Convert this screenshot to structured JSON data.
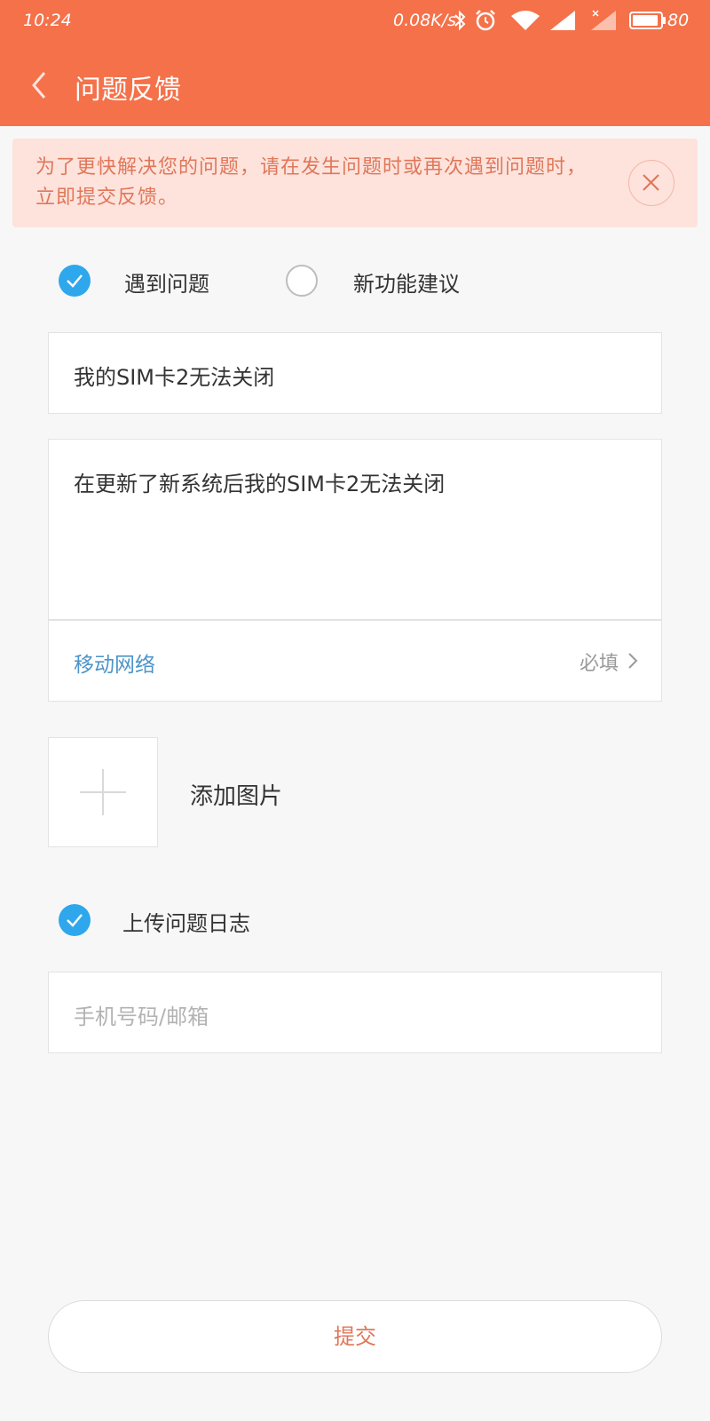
{
  "status_bar": {
    "time": "10:24",
    "network_speed": "0.08K/s",
    "battery": "80",
    "icons": [
      "bluetooth-icon",
      "alarm-icon",
      "wifi-icon",
      "signal-icon",
      "signal-no-sim-icon",
      "battery-icon"
    ]
  },
  "header": {
    "title": "问题反馈",
    "back_icon": "chevron-left-icon",
    "background_color": "#f4714a"
  },
  "notice": {
    "text": "为了更快解决您的问题，请在发生问题时或再次遇到问题时，立即提交反馈。",
    "close_icon": "close-icon"
  },
  "feedback_type": {
    "options": [
      {
        "label": "遇到问题",
        "selected": true
      },
      {
        "label": "新功能建议",
        "selected": false
      }
    ]
  },
  "form": {
    "title_value": "我的SIM卡2无法关闭",
    "description_value": "在更新了新系统后我的SIM卡2无法关闭",
    "category_label": "移动网络",
    "category_required": "必填",
    "add_image_label": "添加图片",
    "upload_log_label": "上传问题日志",
    "upload_log_checked": true,
    "contact_placeholder": "手机号码/邮箱"
  },
  "submit_label": "提交",
  "colors": {
    "accent": "#f4714a",
    "check_blue": "#2ea7ec",
    "link_blue": "#4d95c9",
    "notice_bg": "#fde3dc",
    "notice_text": "#e0775a"
  }
}
